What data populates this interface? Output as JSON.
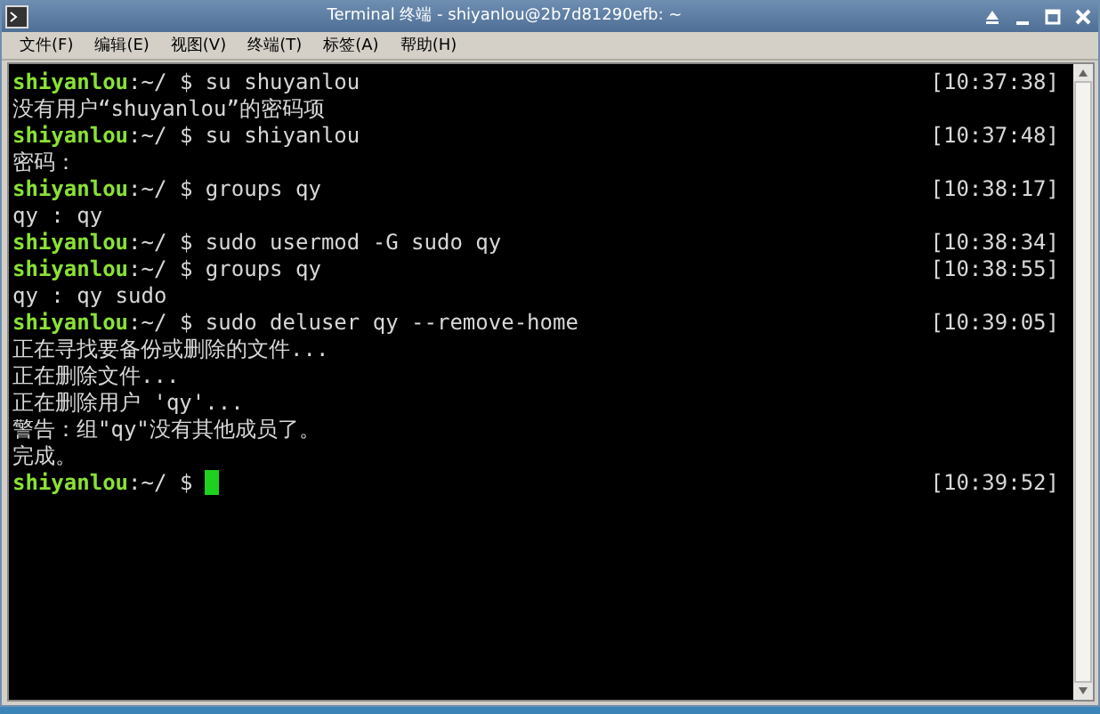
{
  "window": {
    "title": "Terminal 终端 - shiyanlou@2b7d81290efb: ~"
  },
  "menu": [
    "文件(F)",
    "编辑(E)",
    "视图(V)",
    "终端(T)",
    "标签(A)",
    "帮助(H)"
  ],
  "terminal": {
    "lines": [
      {
        "kind": "prompt",
        "user": "shiyanlou",
        "path": ":~/",
        "symbol": "$",
        "command": "su shuyanlou",
        "time": "[10:37:38]",
        "cursor": false
      },
      {
        "kind": "output",
        "text": "没有用户“shuyanlou”的密码项"
      },
      {
        "kind": "prompt",
        "user": "shiyanlou",
        "path": ":~/",
        "symbol": "$",
        "command": "su shiyanlou",
        "time": "[10:37:48]",
        "cursor": false
      },
      {
        "kind": "output",
        "text": "密码："
      },
      {
        "kind": "prompt",
        "user": "shiyanlou",
        "path": ":~/",
        "symbol": "$",
        "command": "groups qy",
        "time": "[10:38:17]",
        "cursor": false
      },
      {
        "kind": "output",
        "text": "qy : qy"
      },
      {
        "kind": "prompt",
        "user": "shiyanlou",
        "path": ":~/",
        "symbol": "$",
        "command": "sudo usermod -G sudo qy",
        "time": "[10:38:34]",
        "cursor": false
      },
      {
        "kind": "prompt",
        "user": "shiyanlou",
        "path": ":~/",
        "symbol": "$",
        "command": "groups qy",
        "time": "[10:38:55]",
        "cursor": false
      },
      {
        "kind": "output",
        "text": "qy : qy sudo"
      },
      {
        "kind": "prompt",
        "user": "shiyanlou",
        "path": ":~/",
        "symbol": "$",
        "command": "sudo deluser qy --remove-home",
        "time": "[10:39:05]",
        "cursor": false
      },
      {
        "kind": "output",
        "text": "正在寻找要备份或删除的文件..."
      },
      {
        "kind": "output",
        "text": "正在删除文件..."
      },
      {
        "kind": "output",
        "text": "正在删除用户 'qy'..."
      },
      {
        "kind": "output",
        "text": "警告：组\"qy\"没有其他成员了。"
      },
      {
        "kind": "output",
        "text": "完成。"
      },
      {
        "kind": "prompt",
        "user": "shiyanlou",
        "path": ":~/",
        "symbol": "$",
        "time": "[10:39:52]",
        "cursor": true
      }
    ]
  }
}
